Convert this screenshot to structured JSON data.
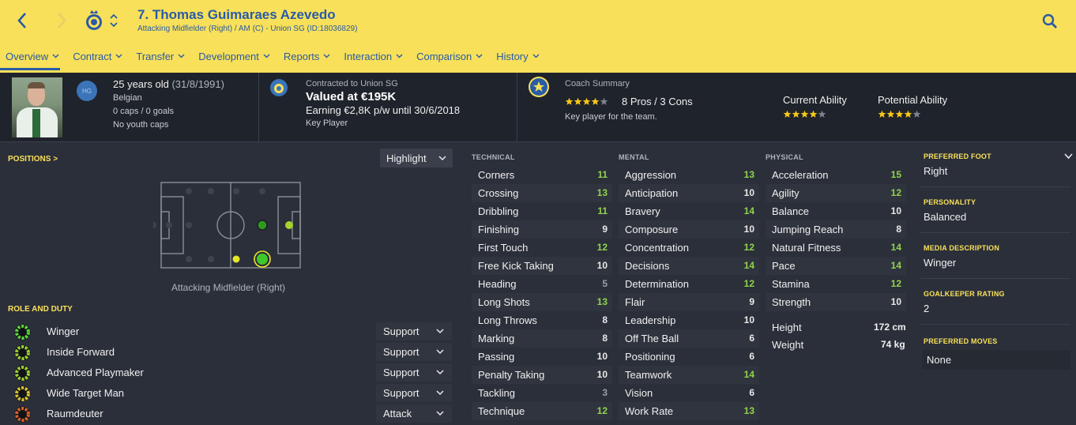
{
  "header": {
    "title": "7. Thomas Guimaraes Azevedo",
    "subtitle": "Attacking Midfielder (Right) / AM (C) - Union SG (ID:18036829)",
    "bg_color": "#f8e05a",
    "accent_color": "#2a5ba6",
    "tabs": [
      {
        "label": "Overview",
        "active": true
      },
      {
        "label": "Contract"
      },
      {
        "label": "Transfer"
      },
      {
        "label": "Development"
      },
      {
        "label": "Reports"
      },
      {
        "label": "Interaction"
      },
      {
        "label": "Comparison"
      },
      {
        "label": "History"
      }
    ]
  },
  "profile": {
    "badge": "HG",
    "age": "25 years old",
    "dob": "(31/8/1991)",
    "nationality": "Belgian",
    "caps": "0 caps / 0 goals",
    "youth_caps": "No youth caps"
  },
  "contract": {
    "label": "Contracted to Union SG",
    "value": "Valued at €195K",
    "earning": "Earning €2,8K p/w until 30/6/2018",
    "status": "Key Player"
  },
  "coach": {
    "label": "Coach Summary",
    "stars": 4,
    "pros_cons": "8 Pros / 3 Cons",
    "description": "Key player for the team.",
    "current_ability_label": "Current Ability",
    "current_ability_stars": 4,
    "potential_ability_label": "Potential Ability",
    "potential_ability_stars": 4
  },
  "positions": {
    "title": "POSITIONS >",
    "dropdown": "Highlight",
    "label": "Attacking Midfielder (Right)"
  },
  "roles": {
    "title": "ROLE AND DUTY",
    "items": [
      {
        "name": "Winger",
        "duty": "Support",
        "color": "#5cd33a"
      },
      {
        "name": "Inside Forward",
        "duty": "Support",
        "color": "#9acd32"
      },
      {
        "name": "Advanced Playmaker",
        "duty": "Support",
        "color": "#9acd32"
      },
      {
        "name": "Wide Target Man",
        "duty": "Support",
        "color": "#d4c12e"
      },
      {
        "name": "Raumdeuter",
        "duty": "Attack",
        "color": "#d2622b"
      }
    ]
  },
  "attributes": {
    "technical_title": "TECHNICAL",
    "mental_title": "MENTAL",
    "physical_title": "PHYSICAL",
    "technical": [
      {
        "name": "Corners",
        "value": "11"
      },
      {
        "name": "Crossing",
        "value": "13"
      },
      {
        "name": "Dribbling",
        "value": "11"
      },
      {
        "name": "Finishing",
        "value": "9"
      },
      {
        "name": "First Touch",
        "value": "12"
      },
      {
        "name": "Free Kick Taking",
        "value": "10"
      },
      {
        "name": "Heading",
        "value": "5"
      },
      {
        "name": "Long Shots",
        "value": "13"
      },
      {
        "name": "Long Throws",
        "value": "8"
      },
      {
        "name": "Marking",
        "value": "8"
      },
      {
        "name": "Passing",
        "value": "10"
      },
      {
        "name": "Penalty Taking",
        "value": "10"
      },
      {
        "name": "Tackling",
        "value": "3"
      },
      {
        "name": "Technique",
        "value": "12"
      }
    ],
    "mental": [
      {
        "name": "Aggression",
        "value": "13"
      },
      {
        "name": "Anticipation",
        "value": "10"
      },
      {
        "name": "Bravery",
        "value": "14"
      },
      {
        "name": "Composure",
        "value": "10"
      },
      {
        "name": "Concentration",
        "value": "12"
      },
      {
        "name": "Decisions",
        "value": "14"
      },
      {
        "name": "Determination",
        "value": "12"
      },
      {
        "name": "Flair",
        "value": "9"
      },
      {
        "name": "Leadership",
        "value": "10"
      },
      {
        "name": "Off The Ball",
        "value": "6"
      },
      {
        "name": "Positioning",
        "value": "6"
      },
      {
        "name": "Teamwork",
        "value": "14"
      },
      {
        "name": "Vision",
        "value": "6"
      },
      {
        "name": "Work Rate",
        "value": "13"
      }
    ],
    "physical": [
      {
        "name": "Acceleration",
        "value": "15"
      },
      {
        "name": "Agility",
        "value": "12"
      },
      {
        "name": "Balance",
        "value": "10"
      },
      {
        "name": "Jumping Reach",
        "value": "8"
      },
      {
        "name": "Natural Fitness",
        "value": "14"
      },
      {
        "name": "Pace",
        "value": "14"
      },
      {
        "name": "Stamina",
        "value": "12"
      },
      {
        "name": "Strength",
        "value": "10"
      }
    ],
    "height_label": "Height",
    "height": "172 cm",
    "weight_label": "Weight",
    "weight": "74 kg"
  },
  "details": {
    "foot_title": "PREFERRED FOOT",
    "foot": "Right",
    "personality_title": "PERSONALITY",
    "personality": "Balanced",
    "media_title": "MEDIA DESCRIPTION",
    "media": "Winger",
    "gk_title": "GOALKEEPER RATING",
    "gk": "2",
    "moves_title": "PREFERRED MOVES",
    "moves": "None"
  }
}
